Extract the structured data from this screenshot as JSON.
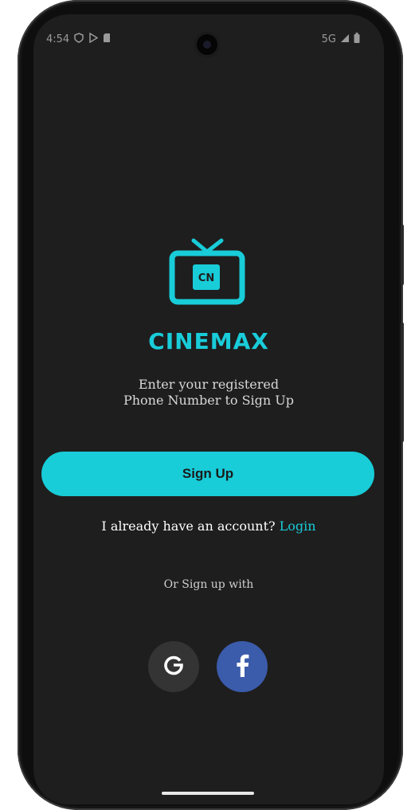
{
  "status_bar": {
    "time": "4:54",
    "network": "5G"
  },
  "brand": {
    "logo_text": "CN",
    "name": "CINEMAX"
  },
  "subtitle": {
    "line1": "Enter your registered",
    "line2": "Phone Number to Sign Up"
  },
  "signup_button": {
    "label": "Sign Up"
  },
  "account_prompt": {
    "text": "I already have an account?",
    "login_label": "Login"
  },
  "social": {
    "heading": "Or Sign up with",
    "google_icon": "google-icon",
    "facebook_icon": "facebook-icon"
  },
  "colors": {
    "accent": "#18ccd8",
    "background": "#1e1e1e",
    "google_bg": "#343434",
    "facebook_bg": "#3b5bab"
  }
}
